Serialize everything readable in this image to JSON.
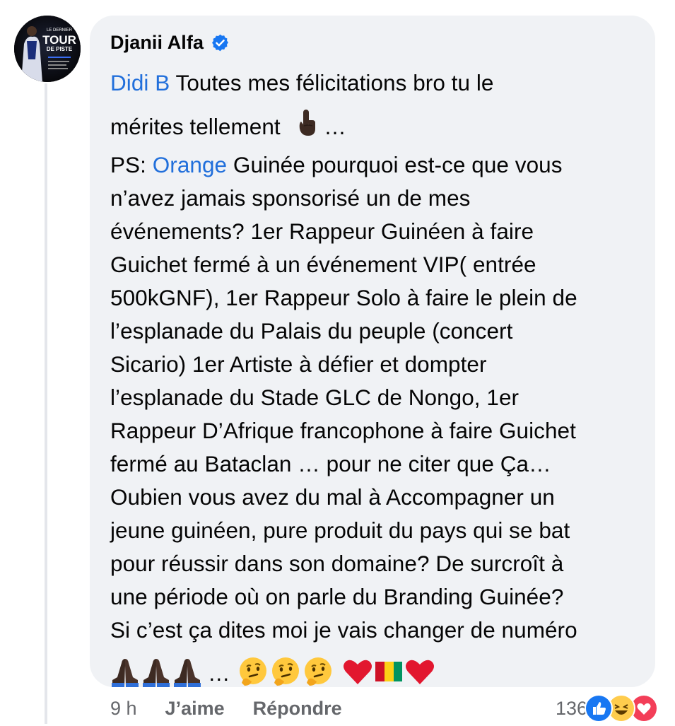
{
  "comment": {
    "author": "Djanii Alfa",
    "avatar_text": [
      "LE DERNIER",
      "TOUR",
      "DE PISTE"
    ],
    "line1_mention": "Didi B",
    "line1_rest": " Toutes mes félicitations bro tu le",
    "line2_text": "mérites tellement",
    "line2_dots": " …",
    "line3_prefix": "PS: ",
    "line3_mention": "Orange",
    "line3_rest": " Guinée pourquoi est-ce que vous",
    "lines": [
      "n’avez jamais sponsorisé un de mes",
      "événements? 1er Rappeur Guinéen à faire",
      "Guichet fermé à un événement VIP( entrée",
      "500kGNF), 1er Rappeur Solo à faire le plein de",
      "l’esplanade du Palais du peuple (concert",
      "Sicario) 1er Artiste à défier et dompter",
      "l’esplanade du Stade GLC de Nongo, 1er",
      "Rappeur D’Afrique francophone à faire Guichet",
      "fermé au Bataclan … pour ne citer que Ça…",
      "Oubien vous avez du mal à Accompagner un",
      "jeune guinéen, pure produit du pays qui se bat",
      "pour réussir dans son domaine? De surcroît à",
      "une période où on parle du Branding Guinée?",
      "Si c’est ça dites moi je vais changer de numéro"
    ],
    "emoji_dots": "…",
    "emojis": [
      "praying-hands",
      "praying-hands",
      "praying-hands",
      "thinking-face",
      "thinking-face",
      "thinking-face",
      "red-heart",
      "guinea-flag",
      "red-heart"
    ]
  },
  "footer": {
    "time": "9 h",
    "like_label": "J’aime",
    "reply_label": "Répondre",
    "reaction_count": "136",
    "reaction_icons": [
      "like-icon",
      "haha-icon",
      "love-icon"
    ]
  },
  "colors": {
    "mention": "#216fdb",
    "bubble": "#f0f2f5",
    "verified": "#1877f2",
    "secondary_text": "#65676b"
  }
}
